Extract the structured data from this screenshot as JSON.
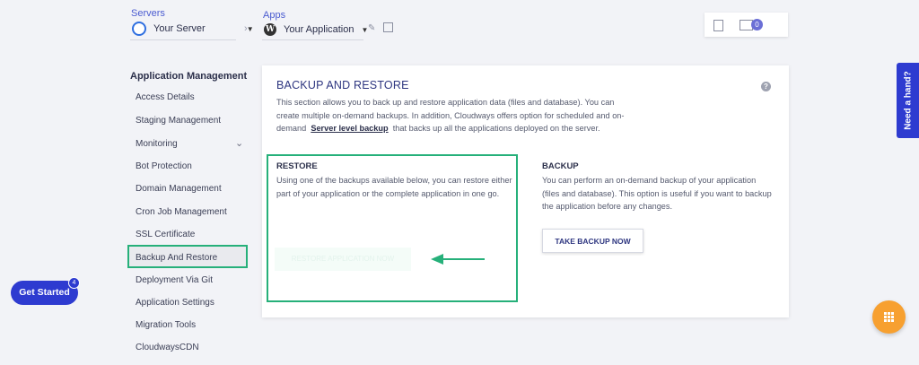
{
  "header": {
    "servers_label": "Servers",
    "server_value": "Your Server",
    "apps_label": "Apps",
    "app_value": "Your Application",
    "notifications_count": "0"
  },
  "sidebar": {
    "title": "Application Management",
    "items": [
      {
        "label": "Access Details"
      },
      {
        "label": "Staging Management"
      },
      {
        "label": "Monitoring"
      },
      {
        "label": "Bot Protection"
      },
      {
        "label": "Domain Management"
      },
      {
        "label": "Cron Job Management"
      },
      {
        "label": "SSL Certificate"
      },
      {
        "label": "Backup And Restore"
      },
      {
        "label": "Deployment Via Git"
      },
      {
        "label": "Application Settings"
      },
      {
        "label": "Migration Tools"
      },
      {
        "label": "CloudwaysCDN"
      }
    ]
  },
  "main": {
    "title": "BACKUP AND RESTORE",
    "desc_1": "This section allows you to back up and restore application data (files and database). You can",
    "desc_2": "create multiple on-demand backups. In addition, Cloudways offers option for scheduled and on-",
    "desc_3a": "demand",
    "desc_link": "Server level backup",
    "desc_3b": "that backs up all the applications deployed on the server.",
    "restore": {
      "title": "RESTORE",
      "line1": "Using one of the backups available below, you can restore either",
      "line2": "part of your application or the complete application in one go.",
      "button": "RESTORE APPLICATION NOW"
    },
    "backup": {
      "title": "BACKUP",
      "line1": "You can perform an on-demand backup of your application",
      "line2": "(files and database). This option is useful if you want to backup",
      "line3": "the application before any changes.",
      "button": "TAKE BACKUP NOW"
    }
  },
  "floating": {
    "need_hand": "Need a hand?",
    "get_started": "Get Started",
    "get_started_badge": "4"
  },
  "colors": {
    "accent": "#2e3bd0",
    "highlight": "#26b07a",
    "fab": "#f7a030"
  }
}
